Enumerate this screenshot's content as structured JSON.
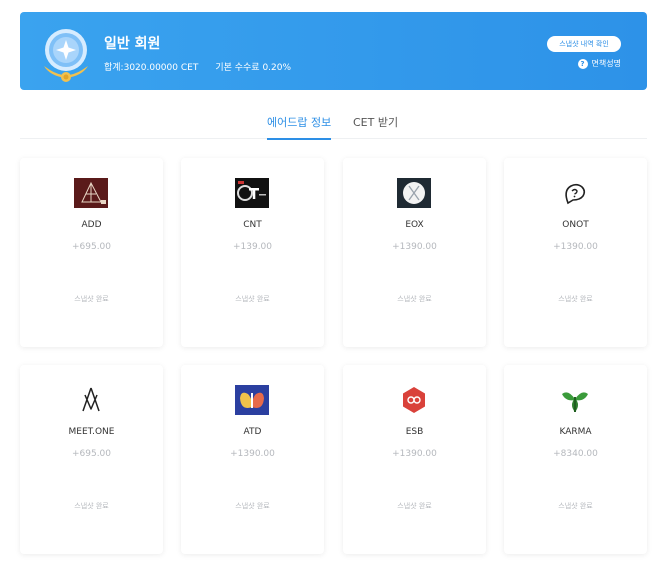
{
  "header": {
    "member_title": "일반 회원",
    "total": "합계:3020.00000 CET",
    "base_fee": "기본 수수료 0.20%",
    "history_button": "스냅샷 내역 확인",
    "disclaimer": "면책성명",
    "help_icon_glyph": "?",
    "accent_color": "#2d8fe6"
  },
  "tabs": [
    {
      "label": "에어드랍 정보",
      "active": true
    },
    {
      "label": "CET 받기",
      "active": false
    }
  ],
  "cards": [
    {
      "name": "ADD",
      "amount": "+695.00",
      "status": "스냅샷 완료",
      "icon": "add-logo-icon"
    },
    {
      "name": "CNT",
      "amount": "+139.00",
      "status": "스냅샷 완료",
      "icon": "cnt-logo-icon"
    },
    {
      "name": "EOX",
      "amount": "+1390.00",
      "status": "스냅샷 완료",
      "icon": "eox-logo-icon"
    },
    {
      "name": "ONOT",
      "amount": "+1390.00",
      "status": "스냅샷 완료",
      "icon": "onot-logo-icon"
    },
    {
      "name": "MEET.ONE",
      "amount": "+695.00",
      "status": "스냅샷 완료",
      "icon": "meetone-logo-icon"
    },
    {
      "name": "ATD",
      "amount": "+1390.00",
      "status": "스냅샷 완료",
      "icon": "atd-logo-icon"
    },
    {
      "name": "ESB",
      "amount": "+1390.00",
      "status": "스냅샷 완료",
      "icon": "esb-logo-icon"
    },
    {
      "name": "KARMA",
      "amount": "+8340.00",
      "status": "스냅샷 완료",
      "icon": "karma-logo-icon"
    }
  ]
}
